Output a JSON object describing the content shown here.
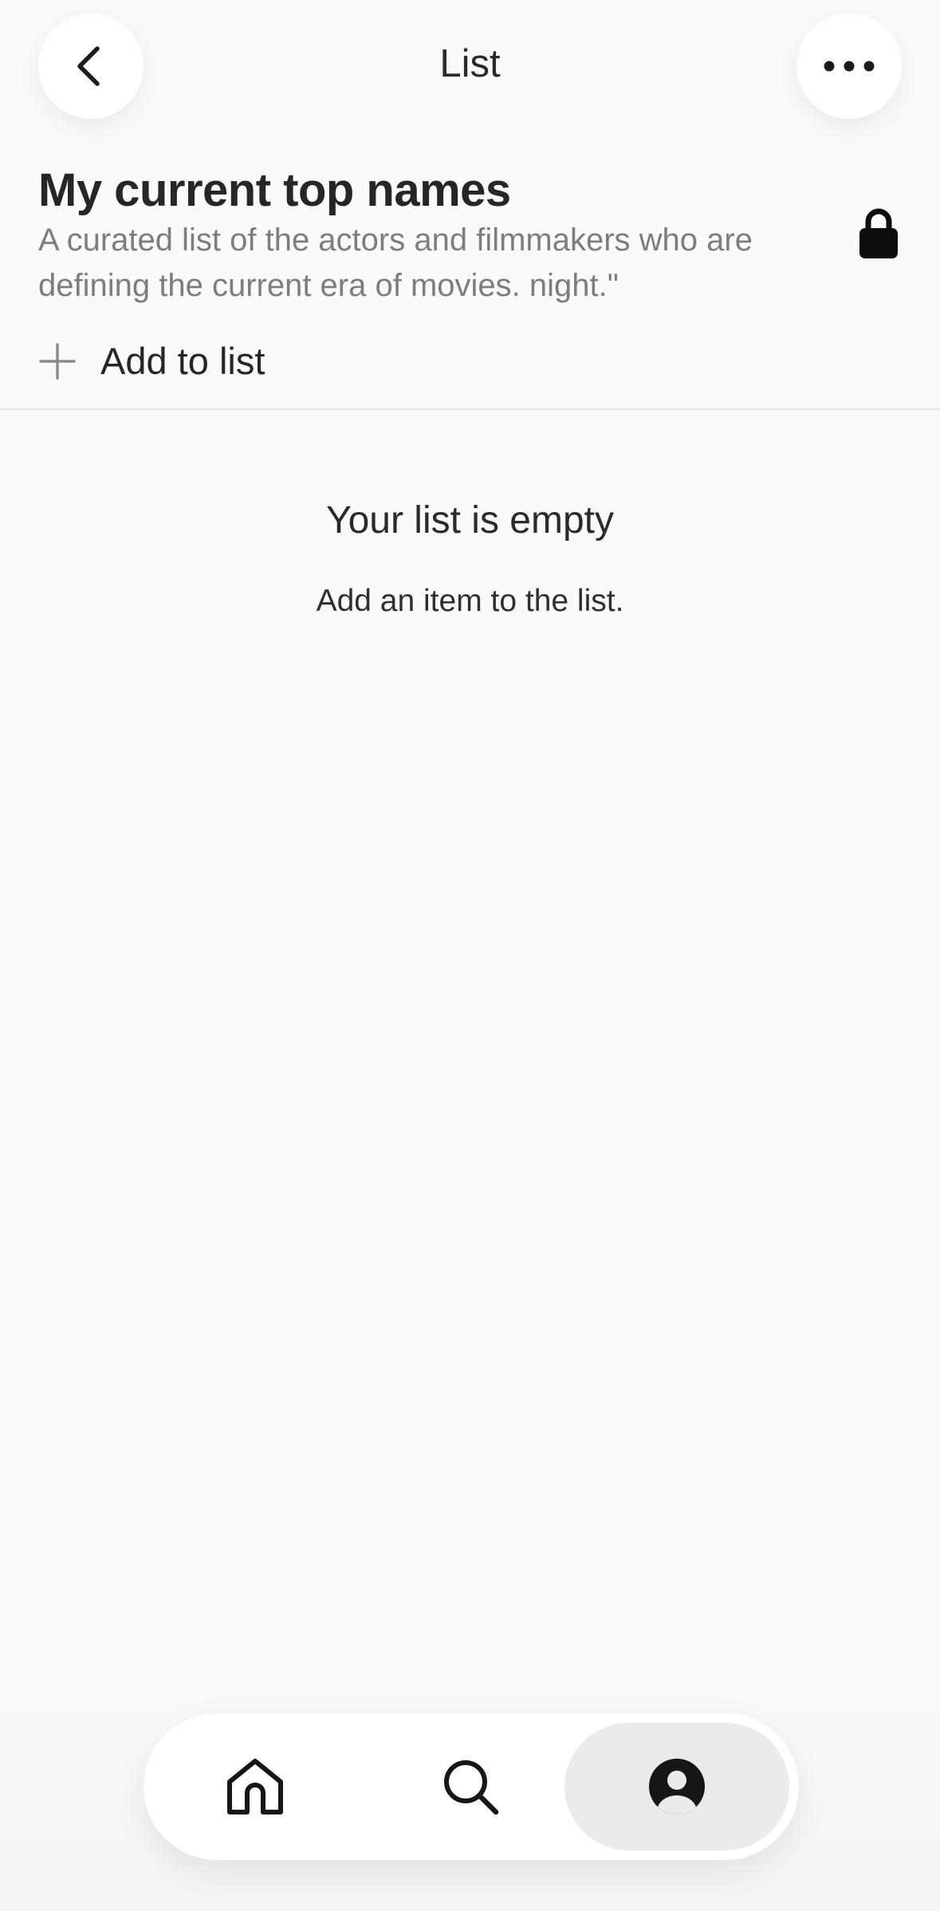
{
  "header": {
    "title": "List",
    "back_icon": "chevron-left-icon",
    "more_icon": "ellipsis-icon"
  },
  "list": {
    "title": "My current top names",
    "description": "A curated list of the actors and filmmakers who are defining the current era of movies. night.\"",
    "privacy_icon": "lock-icon"
  },
  "actions": {
    "add_label": "Add to list",
    "add_icon": "plus-icon"
  },
  "empty_state": {
    "title": "Your list is empty",
    "subtitle": "Add an item to the list."
  },
  "bottom_nav": {
    "items": [
      {
        "icon": "home-icon",
        "selected": false
      },
      {
        "icon": "search-icon",
        "selected": false
      },
      {
        "icon": "profile-icon",
        "selected": true
      }
    ]
  },
  "colors": {
    "background": "#fafafa",
    "surface": "#ffffff",
    "selected_tab": "#ebebeb",
    "text_primary": "#262626",
    "text_secondary": "#7d7d7d"
  }
}
